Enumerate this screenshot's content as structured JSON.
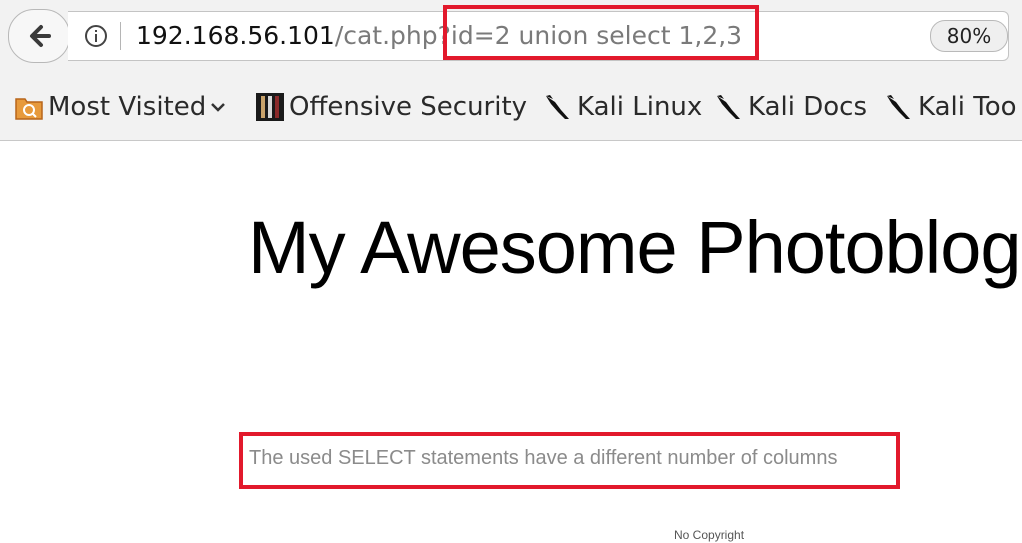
{
  "browser": {
    "url_host": "192.168.56.101",
    "url_path": "/cat.php?id=2 union select 1,2,3",
    "zoom_level": "80%"
  },
  "bookmarks": [
    {
      "label": "Most Visited",
      "icon": "folder-icon"
    },
    {
      "label": "Offensive Security",
      "icon": "offsec-icon"
    },
    {
      "label": "Kali Linux",
      "icon": "kali-dragon-icon"
    },
    {
      "label": "Kali Docs",
      "icon": "kali-dragon-icon"
    },
    {
      "label": "Kali Too",
      "icon": "kali-dragon-icon"
    }
  ],
  "page": {
    "title": "My Awesome Photoblog",
    "error_message": "The used SELECT statements have a different number of columns",
    "footer": "No Copyright"
  },
  "colors": {
    "highlight": "#e2192c"
  }
}
